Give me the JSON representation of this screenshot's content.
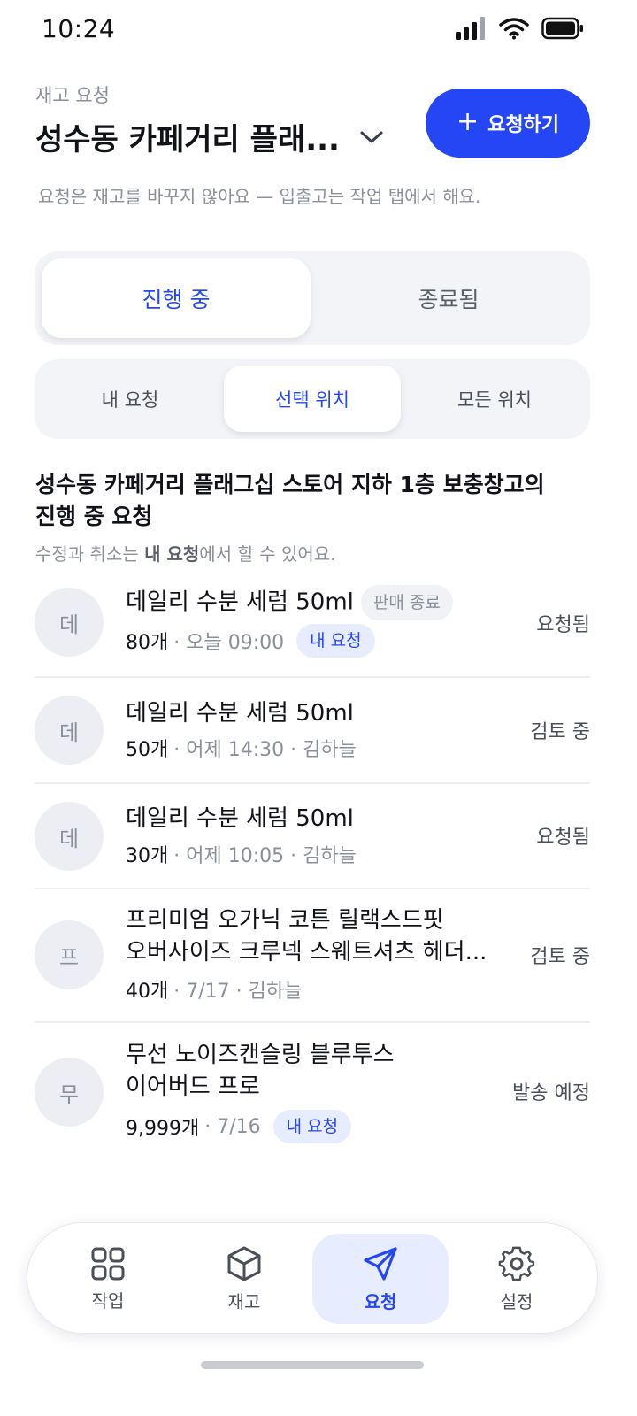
{
  "status_bar": {
    "time": "10:24"
  },
  "header": {
    "small_title": "재고 요청",
    "location_title": "성수동 카페거리 플래...",
    "request_button_label": "요청하기",
    "note": "요청은 재고를 바꾸지 않아요 — 입출고는 작업 탭에서 해요."
  },
  "status_tabs": [
    {
      "label": "진행 중",
      "active": true
    },
    {
      "label": "종료됨",
      "active": false
    }
  ],
  "scope_tabs": [
    {
      "label": "내 요청",
      "active": false
    },
    {
      "label": "선택 위치",
      "active": true
    },
    {
      "label": "모든 위치",
      "active": false
    }
  ],
  "section": {
    "title_line1": "성수동 카페거리 플래그십 스토어 지하 1층 보충창고의",
    "title_line2": "진행 중 요청",
    "note_prefix": "수정과 취소는 ",
    "note_bold": "내 요청",
    "note_suffix": "에서 할 수 있어요."
  },
  "requests": [
    {
      "avatar": "데",
      "name_line1": "데일리 수분 세럼 50ml",
      "name_line2": "",
      "badge_gray": "판매 종료",
      "qty": "80개",
      "meta": "· 오늘 09:00",
      "badge_blue": "내 요청",
      "status": "요청됨"
    },
    {
      "avatar": "데",
      "name_line1": "데일리 수분 세럼 50ml",
      "name_line2": "",
      "badge_gray": "",
      "qty": "50개",
      "meta": "· 어제 14:30 · 김하늘",
      "badge_blue": "",
      "status": "검토 중"
    },
    {
      "avatar": "데",
      "name_line1": "데일리 수분 세럼 50ml",
      "name_line2": "",
      "badge_gray": "",
      "qty": "30개",
      "meta": "· 어제 10:05 · 김하늘",
      "badge_blue": "",
      "status": "요청됨"
    },
    {
      "avatar": "프",
      "name_line1": "프리미엄 오가닉 코튼 릴랙스드핏",
      "name_line2": "오버사이즈 크루넥 스웨트셔츠 헤더...",
      "badge_gray": "",
      "qty": "40개",
      "meta": "· 7/17 · 김하늘",
      "badge_blue": "",
      "status": "검토 중"
    },
    {
      "avatar": "무",
      "name_line1": "무선 노이즈캔슬링 블루투스",
      "name_line2": "이어버드 프로",
      "badge_gray": "",
      "qty": "9,999개",
      "meta": "· 7/16",
      "badge_blue": "내 요청",
      "status": "발송 예정"
    }
  ],
  "bottom_nav": [
    {
      "label": "작업",
      "icon": "grid-icon",
      "active": false
    },
    {
      "label": "재고",
      "icon": "box-icon",
      "active": false
    },
    {
      "label": "요청",
      "icon": "send-icon",
      "active": true
    },
    {
      "label": "설정",
      "icon": "gear-icon",
      "active": false
    }
  ],
  "colors": {
    "accent": "#2446f5",
    "accent_soft": "#e7ecff",
    "muted_text": "#8a8f99",
    "surface": "#f3f4f8"
  }
}
